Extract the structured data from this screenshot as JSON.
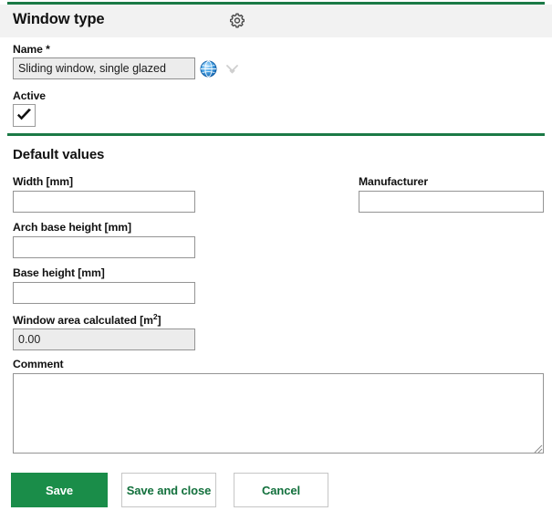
{
  "header": {
    "title": "Window type",
    "settings_icon": "gear-icon"
  },
  "name_section": {
    "label": "Name *",
    "value": "Sliding window, single glazed",
    "placeholder": "",
    "translate_icon": "globe-icon",
    "expand_icon": "chevron-down-icon"
  },
  "active_section": {
    "label": "Active",
    "checked": true,
    "check_icon": "check-icon"
  },
  "default_values": {
    "section_title": "Default values",
    "fields": [
      {
        "label": "Width [mm]",
        "value": "",
        "placeholder": "",
        "readonly": false
      },
      {
        "label": "Arch base height [mm]",
        "value": "",
        "placeholder": "",
        "readonly": false
      },
      {
        "label": "Base height [mm]",
        "value": "",
        "placeholder": "",
        "readonly": false
      },
      {
        "label": "Window area calculated [m",
        "label_sup": "2",
        "label_tail": "]",
        "value": "0.00",
        "placeholder": "",
        "readonly": true
      }
    ],
    "manufacturer": {
      "label": "Manufacturer",
      "value": "",
      "placeholder": ""
    },
    "comment": {
      "label": "Comment",
      "value": "",
      "placeholder": ""
    }
  },
  "buttons": {
    "save": "Save",
    "save_and_close": "Save and close",
    "cancel": "Cancel"
  },
  "colors": {
    "accent_green": "#1a8d49",
    "rule_green": "#1b7a46",
    "header_bg": "#f2f2f2",
    "border_gray": "#949494",
    "field_disabled_bg": "#ececec"
  }
}
